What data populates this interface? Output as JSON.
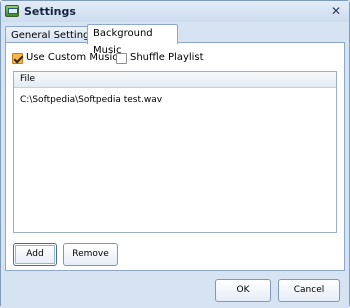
{
  "window": {
    "title": "Settings",
    "icon": "monitor-app-icon"
  },
  "tabs": [
    {
      "label": "General Settings",
      "active": false
    },
    {
      "label": "Background Music",
      "active": true
    }
  ],
  "options": {
    "use_custom_music": {
      "label": "Use Custom Music",
      "checked": true
    },
    "shuffle_playlist": {
      "label": "Shuffle Playlist",
      "checked": false
    }
  },
  "file_list": {
    "header": "File",
    "rows": [
      "C:\\Softpedia\\Softpedia test.wav"
    ]
  },
  "list_buttons": {
    "add": "Add",
    "remove": "Remove"
  },
  "dialog_buttons": {
    "ok": "OK",
    "cancel": "Cancel"
  }
}
